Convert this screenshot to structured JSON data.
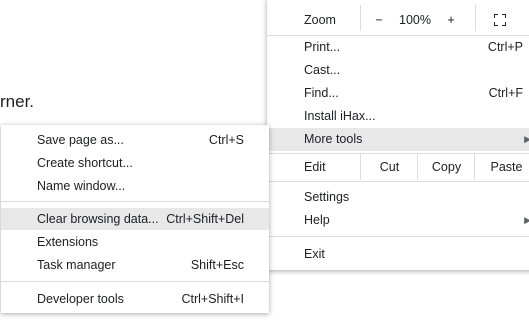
{
  "background": {
    "text": "rner."
  },
  "main_menu": {
    "zoom": {
      "label": "Zoom",
      "minus": "−",
      "value": "100%",
      "plus": "+"
    },
    "items": [
      {
        "label": "Print...",
        "shortcut": "Ctrl+P"
      },
      {
        "label": "Cast...",
        "shortcut": ""
      },
      {
        "label": "Find...",
        "shortcut": "Ctrl+F"
      },
      {
        "label": "Install iHax...",
        "shortcut": ""
      },
      {
        "label": "More tools",
        "shortcut": ""
      }
    ],
    "edit": {
      "label": "Edit",
      "cut": "Cut",
      "copy": "Copy",
      "paste": "Paste"
    },
    "settings": "Settings",
    "help": "Help",
    "exit": "Exit"
  },
  "sub_menu": {
    "items": [
      {
        "label": "Save page as...",
        "shortcut": "Ctrl+S"
      },
      {
        "label": "Create shortcut...",
        "shortcut": ""
      },
      {
        "label": "Name window...",
        "shortcut": ""
      },
      {
        "label": "Clear browsing data...",
        "shortcut": "Ctrl+Shift+Del"
      },
      {
        "label": "Extensions",
        "shortcut": ""
      },
      {
        "label": "Task manager",
        "shortcut": "Shift+Esc"
      },
      {
        "label": "Developer tools",
        "shortcut": "Ctrl+Shift+I"
      }
    ]
  },
  "colors": {
    "highlight": "#e8e8e8",
    "separator": "#dadce0",
    "text": "#202124"
  },
  "icons": {
    "fullscreen": "fullscreen-icon",
    "submenu_arrow": "triangle-right-icon"
  }
}
